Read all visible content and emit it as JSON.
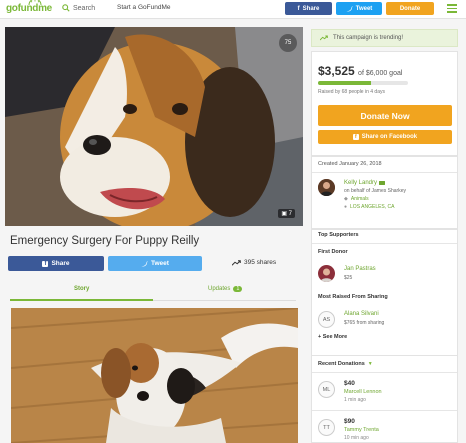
{
  "nav": {
    "logo": "gofundme",
    "search_label": "Search",
    "start_label": "Start a GoFundMe",
    "share_label": "Share",
    "tweet_label": "Tweet",
    "donate_label": "Donate"
  },
  "campaign": {
    "title": "Emergency Surgery For Puppy Reilly",
    "heart_count": "75",
    "photo_count": "7",
    "share_label": "Share",
    "tweet_label": "Tweet",
    "shares_text": "395 shares",
    "tabs": [
      {
        "label": "Story"
      },
      {
        "label": "Updates",
        "badge": "1"
      }
    ]
  },
  "sidebar": {
    "trending_text": "This campaign is trending!",
    "raised": "$3,525",
    "goal_text": "of $6,000 goal",
    "progress_fraction": 0.5875,
    "raised_by": "Raised by 68 people in 4 days",
    "donate_now": "Donate Now",
    "share_facebook": "Share on Facebook",
    "created": "Created January 26, 2018",
    "organizer": {
      "name": "Kelly Landry",
      "behalf": "on behalf of James Sharkey",
      "category": "Animals",
      "location": "LOS ANGELES, CA"
    },
    "top_supporters_label": "Top Supporters",
    "first_donor_label": "First Donor",
    "first_donor": {
      "name": "Jan Pastras",
      "amount": "$25"
    },
    "most_raised_label": "Most Raised From Sharing",
    "most_raised": {
      "initials": "AS",
      "name": "Alana Silvani",
      "amount": "$765 from sharing"
    },
    "see_more": "+ See More",
    "recent_label": "Recent Donations",
    "recent": [
      {
        "initials": "ML",
        "amount": "$40",
        "name": "Marcell Lennon",
        "time": "1 min ago"
      },
      {
        "initials": "TT",
        "amount": "$90",
        "name": "Tammy Trenta",
        "time": "10 min ago"
      }
    ]
  },
  "colors": {
    "brand_green": "#7bb838",
    "donate_orange": "#f1a41f",
    "facebook_blue": "#3b5998",
    "twitter_blue": "#55acee"
  }
}
